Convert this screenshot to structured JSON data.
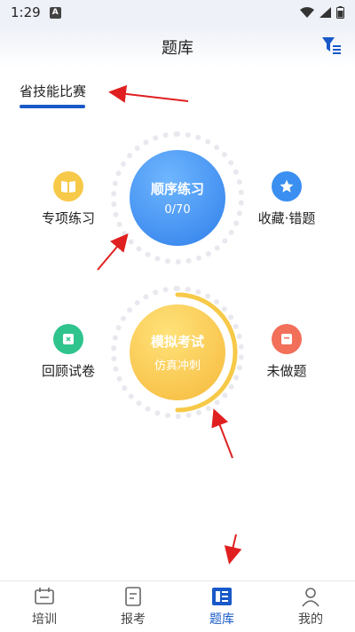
{
  "status": {
    "time": "1:29",
    "notification_letter": "A"
  },
  "header": {
    "title": "题库"
  },
  "tabs": [
    {
      "label": "省技能比赛",
      "active": true
    }
  ],
  "practice": {
    "special": {
      "label": "专项练习",
      "icon": "book-icon",
      "color": "#f7c948"
    },
    "sequential": {
      "title": "顺序练习",
      "progress": "0/70",
      "color": "#3a8ff0"
    },
    "favorites": {
      "label": "收藏·错题",
      "icon": "star-icon",
      "color": "#3a8ff0"
    },
    "review": {
      "label": "回顾试卷",
      "icon": "paper-icon",
      "color": "#2fc38e"
    },
    "mock": {
      "title": "模拟考试",
      "subtitle": "仿真冲刺",
      "color": "#f7c948"
    },
    "undone": {
      "label": "未做题",
      "icon": "note-icon",
      "color": "#f26f5a"
    }
  },
  "nav": [
    {
      "label": "培训",
      "icon": "training-icon",
      "active": false
    },
    {
      "label": "报考",
      "icon": "register-icon",
      "active": false
    },
    {
      "label": "题库",
      "icon": "question-bank-icon",
      "active": true
    },
    {
      "label": "我的",
      "icon": "profile-icon",
      "active": false
    }
  ],
  "accent_color": "#1859c9"
}
